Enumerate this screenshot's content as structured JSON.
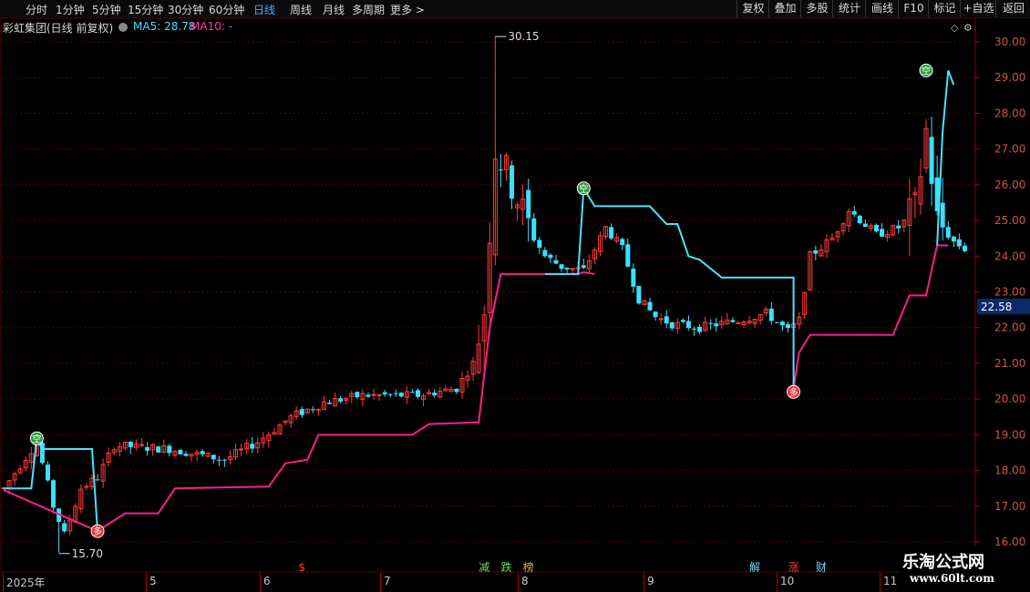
{
  "toolbar": {
    "periods": [
      "分时",
      "1分钟",
      "5分钟",
      "15分钟",
      "30分钟",
      "60分钟",
      "日线",
      "周线",
      "月线",
      "多周期",
      "更多 >"
    ],
    "active_period": "日线",
    "right_buttons": [
      "复权",
      "叠加",
      "多股",
      "统计",
      "画线",
      "F10",
      "标记",
      "+自选",
      "返回"
    ]
  },
  "header": {
    "title": "彩虹集团(日线 前复权)",
    "ma5_label": "MA5: 28.78",
    "ma10_label": "MA10: -",
    "ma5_color": "#4fd8ff",
    "ma10_color": "#ff3c9c"
  },
  "colors": {
    "up": "#ff3a3a",
    "down": "#3ae0ff",
    "line_support": "#ff1c8c",
    "line_resist": "#4fe0ff",
    "grid": "#5a0000"
  },
  "chart_data": {
    "type": "candlestick",
    "y_ticks": [
      "30.00",
      "29.00",
      "28.00",
      "27.00",
      "26.00",
      "25.00",
      "24.00",
      "23.00",
      "22.00",
      "21.00",
      "20.00",
      "19.00",
      "18.00",
      "17.00",
      "16.00"
    ],
    "ylim": [
      15.9,
      30.4
    ],
    "price_marker": "22.58",
    "high_label": "30.15",
    "low_label": "15.70",
    "x_labels": [
      "2025年",
      "5",
      "6",
      "7",
      "8",
      "9",
      "10",
      "11"
    ],
    "signals": [
      {
        "text": "多",
        "kind": "buy",
        "index": 17,
        "price": 16.3
      },
      {
        "text": "空",
        "kind": "sell",
        "index": 6,
        "price": 18.9
      },
      {
        "text": "空",
        "kind": "sell",
        "index": 105,
        "price": 25.9
      },
      {
        "text": "多",
        "kind": "buy",
        "index": 143,
        "price": 20.2
      },
      {
        "text": "空",
        "kind": "sell",
        "index": 167,
        "price": 29.2
      }
    ],
    "event_labels": [
      {
        "text": "$",
        "index": 54,
        "color": "#ff3a3a"
      },
      {
        "text": "减",
        "index": 87,
        "color": "#6bdc6b"
      },
      {
        "text": "跌",
        "index": 91,
        "color": "#6bdc6b"
      },
      {
        "text": "榜",
        "index": 95,
        "color": "#e2b04a"
      },
      {
        "text": "解",
        "index": 136,
        "color": "#6bd8ff"
      },
      {
        "text": "涨",
        "index": 143,
        "color": "#ff3a3a"
      },
      {
        "text": "财",
        "index": 148,
        "color": "#6bd8ff"
      }
    ]
  },
  "watermark": {
    "line1": "乐淘公式网",
    "line2": "www.60lt.com"
  }
}
